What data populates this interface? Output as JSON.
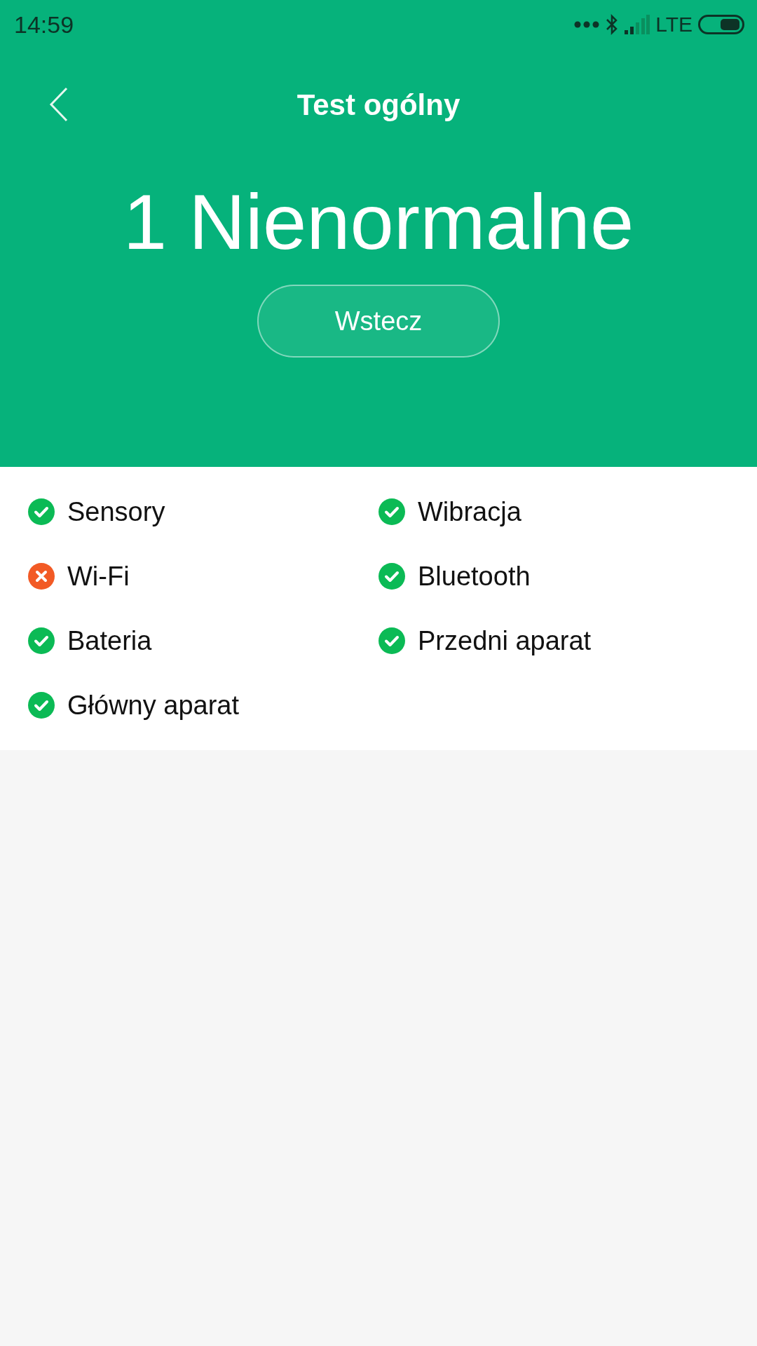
{
  "status_bar": {
    "time": "14:59",
    "network": "LTE"
  },
  "header": {
    "title": "Test ogólny"
  },
  "summary": {
    "result": "1 Nienormalne",
    "button": "Wstecz"
  },
  "tests": [
    {
      "label": "Sensory",
      "passed": true
    },
    {
      "label": "Wibracja",
      "passed": true
    },
    {
      "label": "Wi-Fi",
      "passed": false
    },
    {
      "label": "Bluetooth",
      "passed": true
    },
    {
      "label": "Bateria",
      "passed": true
    },
    {
      "label": "Przedni aparat",
      "passed": true
    },
    {
      "label": "Główny aparat",
      "passed": true
    }
  ]
}
